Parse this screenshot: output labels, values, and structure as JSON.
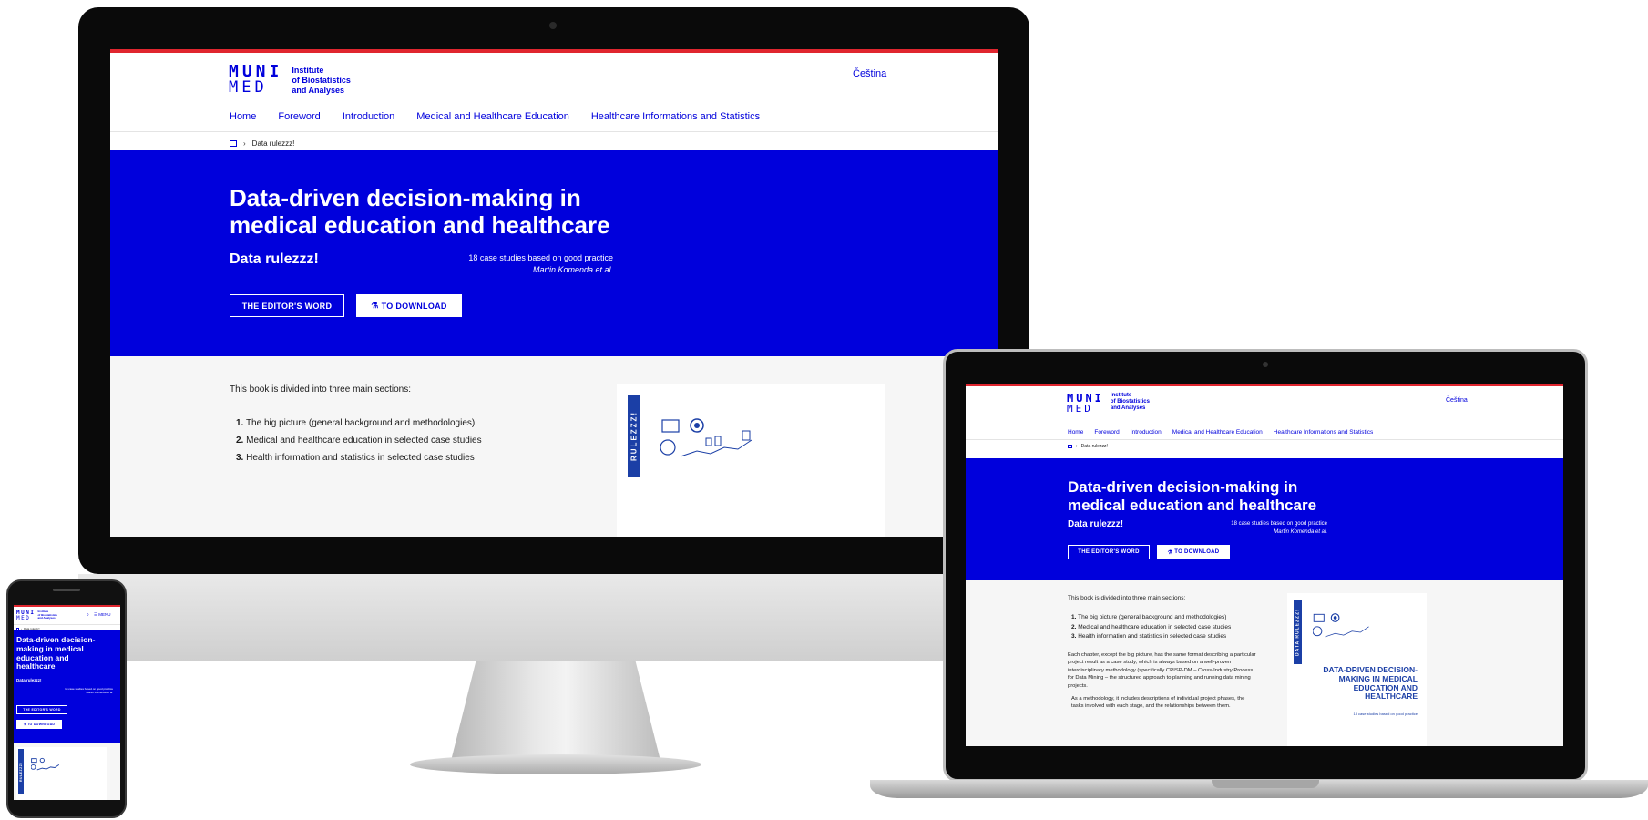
{
  "brand": {
    "logo_top": "MUNI",
    "logo_bottom": "MED",
    "institute_lines": [
      "Institute",
      "of Biostatistics",
      "and Analyses"
    ],
    "accent_color": "#0000dc",
    "topbar_color": "#e0262f",
    "spine_color": "#1b3fa6"
  },
  "header": {
    "language_link": "Čeština",
    "menu_label": "MENU",
    "search_icon": "search-icon"
  },
  "nav": {
    "items": [
      "Home",
      "Foreword",
      "Introduction",
      "Medical and Healthcare Education",
      "Healthcare Informations and Statistics"
    ]
  },
  "breadcrumb": {
    "home_icon": "home-icon",
    "separator": "›",
    "current": "Data rulezzz!"
  },
  "hero": {
    "title": "Data-driven decision-making in medical education and healthcare",
    "subtitle": "Data rulezzz!",
    "meta_line": "18 case studies based on good practice",
    "authors": "Martin Komenda et al.",
    "button_editor": "THE EDITOR'S WORD",
    "button_download": "TO DOWNLOAD",
    "download_icon": "flask-icon"
  },
  "content": {
    "intro": "This book is divided into three main sections:",
    "sections": [
      {
        "num": "1.",
        "text": "The big picture (general background and methodologies)"
      },
      {
        "num": "2.",
        "text": "Medical and healthcare education in selected case studies"
      },
      {
        "num": "3.",
        "text": "Health information and statistics in selected case studies"
      }
    ],
    "para1": "Each chapter, except the big picture, has the same format describing a particular project result as a case study, which is always based on a well-proven interdisciplinary methodology (specifically CRISP-DM – Cross-Industry Process for Data Mining – the structured approach to planning and running data mining projects.",
    "para2": "As a methodology, it includes descriptions of individual project phases, the tasks involved with each stage, and the relationships between them."
  },
  "book": {
    "spine_short": "RULEZZZ!",
    "spine_long": "DATA RULEZZZ!",
    "cover_title": "DATA-DRIVEN DECISION-MAKING IN MEDICAL EDUCATION AND HEALTHCARE",
    "cover_sub": "18 case studies based on good practice"
  }
}
